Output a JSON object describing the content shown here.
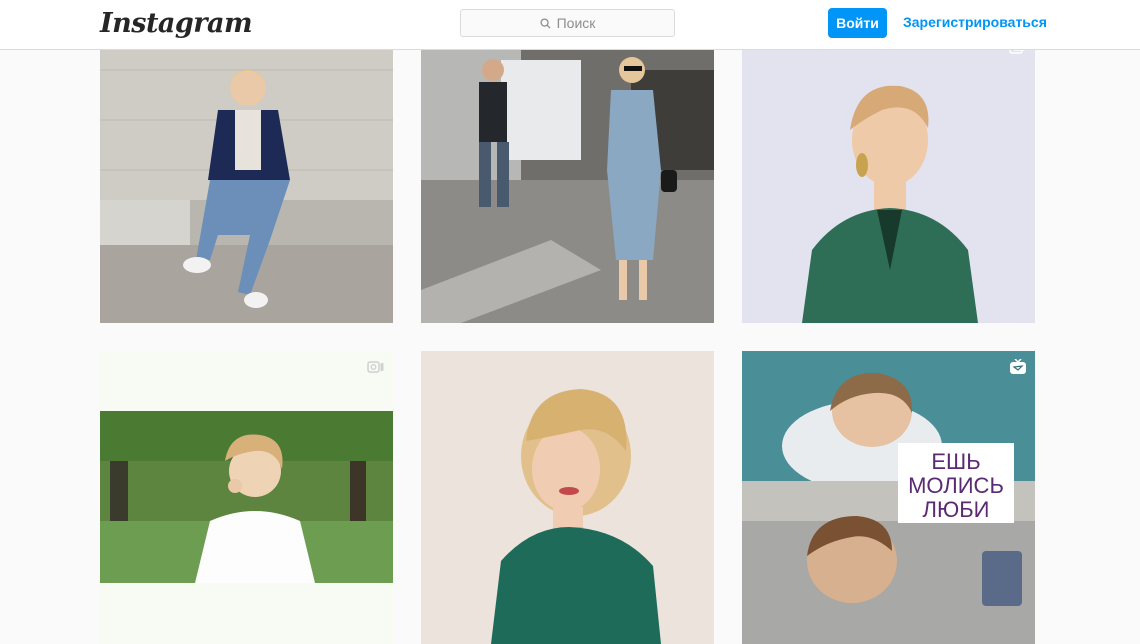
{
  "header": {
    "logo": "Instagram",
    "search_placeholder": "Поиск",
    "login_label": "Войти",
    "signup_label": "Зарегистрироваться"
  },
  "colors": {
    "accent": "#0095f6",
    "border": "#dbdbdb",
    "background": "#fafafa"
  },
  "posts": [
    {
      "id": "post-1",
      "type": "photo",
      "badge": "none"
    },
    {
      "id": "post-2",
      "type": "photo",
      "badge": "none"
    },
    {
      "id": "post-3",
      "type": "photo",
      "badge": "multi-photo-icon"
    },
    {
      "id": "post-4",
      "type": "video",
      "badge": "video-icon"
    },
    {
      "id": "post-5",
      "type": "photo",
      "badge": "none"
    },
    {
      "id": "post-6",
      "type": "igtv",
      "badge": "igtv-icon",
      "overlay_text": [
        "ЕШЬ",
        "МОЛИСЬ",
        "ЛЮБИ"
      ]
    }
  ]
}
